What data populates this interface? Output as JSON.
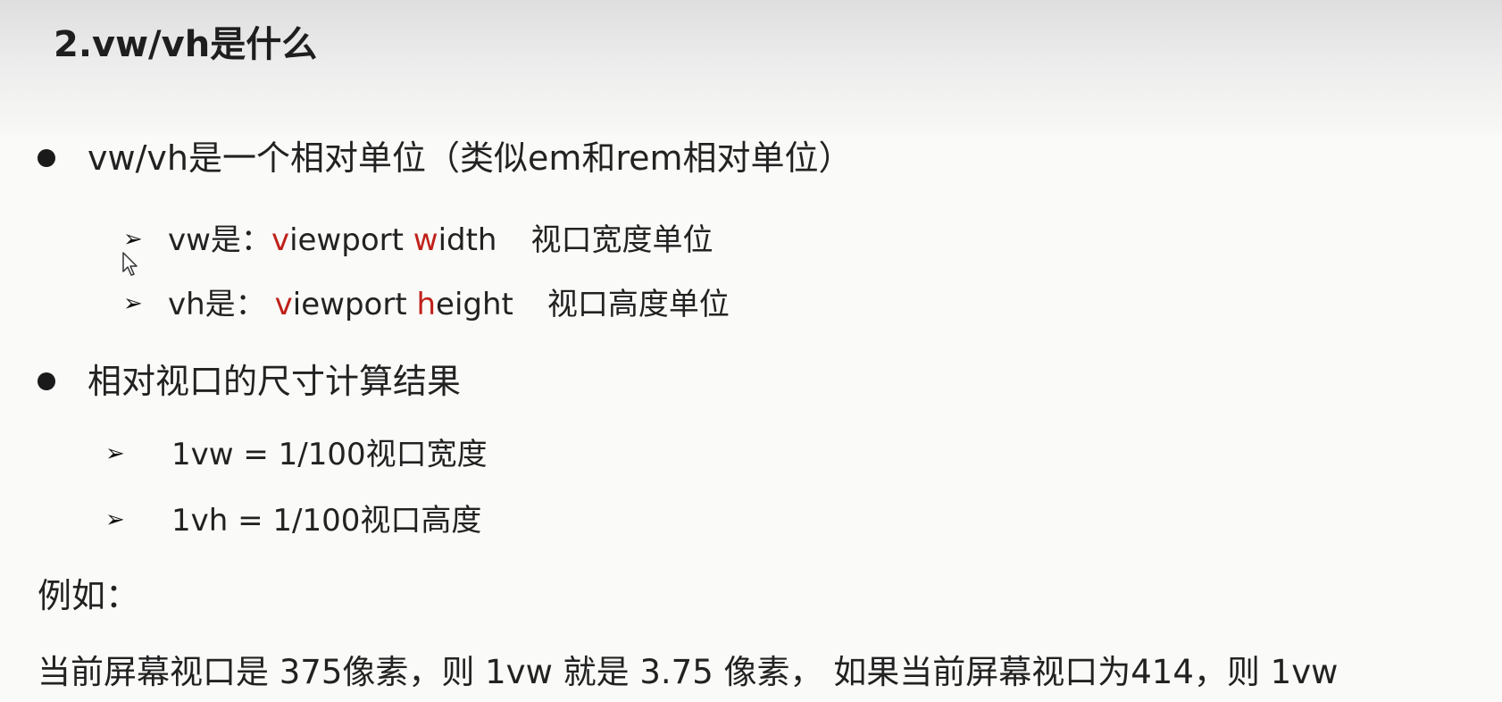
{
  "slide": {
    "title": "2.vw/vh是什么",
    "bullet1": {
      "text": "vw/vh是一个相对单位（类似em和rem相对单位）",
      "sub1": {
        "prefix": "vw是：",
        "v": "v",
        "iewport": "iewport ",
        "w": "w",
        "idth": "idth",
        "desc": "视口宽度单位"
      },
      "sub2": {
        "prefix": "vh是：",
        "v": "v",
        "iewport": "iewport ",
        "h": "h",
        "eight": "eight",
        "desc": "视口高度单位"
      }
    },
    "bullet2": {
      "text": "相对视口的尺寸计算结果",
      "sub1": "1vw = 1/100视口宽度",
      "sub2": "1vh = 1/100视口高度"
    },
    "example_label": "例如：",
    "example_text": "当前屏幕视口是 375像素，则 1vw 就是  3.75 像素， 如果当前屏幕视口为414，则 1vw"
  },
  "colors": {
    "accent_red": "#c0201a",
    "text": "#222222",
    "background": "#fafaf8"
  },
  "icons": {
    "bullet": "filled-circle",
    "sub_bullet": "arrowhead",
    "cursor": "mouse-pointer-icon"
  }
}
